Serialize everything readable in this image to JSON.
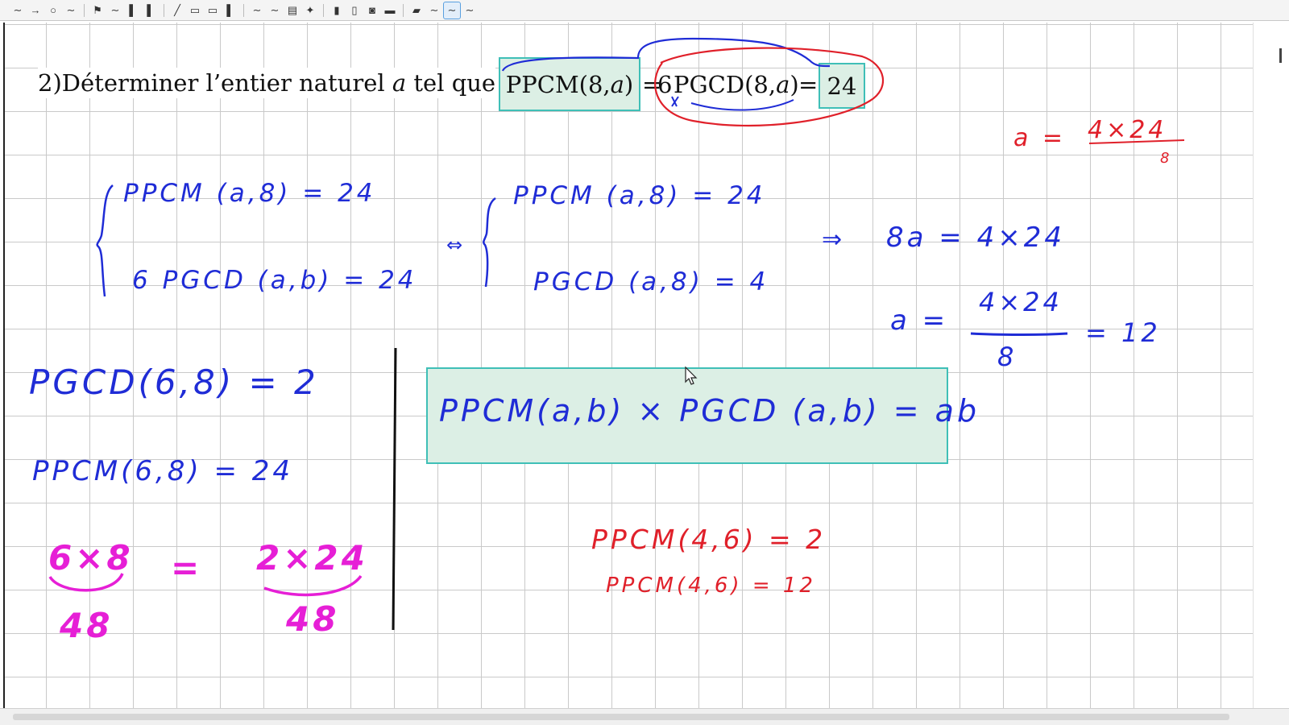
{
  "toolbar": {
    "tools": [
      {
        "icon": "pen-icon",
        "glyph": "∼"
      },
      {
        "icon": "arrow-icon",
        "glyph": "→"
      },
      {
        "icon": "circle-icon",
        "glyph": "○"
      },
      {
        "icon": "freehand-icon",
        "glyph": "∼"
      },
      {
        "icon": "sep"
      },
      {
        "icon": "flag-icon",
        "glyph": "⚑"
      },
      {
        "icon": "red-pen-icon",
        "glyph": "∼"
      },
      {
        "icon": "yellow-highlighter-icon",
        "glyph": "▌"
      },
      {
        "icon": "cyan-highlighter-icon",
        "glyph": "▌"
      },
      {
        "icon": "sep"
      },
      {
        "icon": "line-icon",
        "glyph": "╱"
      },
      {
        "icon": "text-icon",
        "glyph": "▭"
      },
      {
        "icon": "ruler-icon",
        "glyph": "▭"
      },
      {
        "icon": "green-marker-icon",
        "glyph": "▌"
      },
      {
        "icon": "sep"
      },
      {
        "icon": "wave-icon",
        "glyph": "∼"
      },
      {
        "icon": "wave2-icon",
        "glyph": "∼"
      },
      {
        "icon": "stamp-icon",
        "glyph": "▤"
      },
      {
        "icon": "figure-icon",
        "glyph": "✦"
      },
      {
        "icon": "sep"
      },
      {
        "icon": "book-icon",
        "glyph": "▮"
      },
      {
        "icon": "mobile-icon",
        "glyph": "▯"
      },
      {
        "icon": "camera-icon",
        "glyph": "◙"
      },
      {
        "icon": "screen-icon",
        "glyph": "▬"
      },
      {
        "icon": "sep"
      },
      {
        "icon": "record-icon",
        "glyph": "▰"
      },
      {
        "icon": "stroke-icon",
        "glyph": "∼"
      },
      {
        "icon": "active-pen-icon",
        "glyph": "∼",
        "active": true
      },
      {
        "icon": "stroke2-icon",
        "glyph": "∼"
      }
    ]
  },
  "title": {
    "prefix": "2)Déterminer l’entier naturel 𝑎 tel que",
    "box1": "PPCM(8,𝑎)",
    "eq1": "=",
    "six": "6",
    "pgcd": "PGCD(8,𝑎)",
    "eq2": "=",
    "box2": "24"
  },
  "notes": {
    "sys1_line1": "PPCM (a,8) = 24",
    "sys1_line2": "6 PGCD (a,b) = 24",
    "equiv": "⇔",
    "sys2_line1": "PPCM (a,8) = 24",
    "sys2_line2": "PGCD (a,8) = 4",
    "implies": "⇒",
    "eq_8a": "8a = 4×24",
    "a_lhs": "a =",
    "a_num": "4×24",
    "a_den": "8",
    "a_result": "= 12",
    "red_a_lhs": "a =",
    "red_a_num": "4×24",
    "red_a_den": "8",
    "pgcd_68": "PGCD(6,8) = 2",
    "ppcm_68": "PPCM(6,8) =  24",
    "mag_num_left": "6×8",
    "mag_eq": "=",
    "mag_num_right": "2×24",
    "mag_den_left": "48",
    "mag_den_right": "48",
    "formula": "PPCM(a,b) × PGCD (a,b) = ab",
    "red_ppcm1": "PPCM(4,6) = 2",
    "red_ppcm2": "PPCM(4,6) = 12"
  },
  "colors": {
    "blue_ink": "#1f2cd6",
    "red_ink": "#e0202a",
    "magenta_ink": "#e61fd6",
    "box_border": "#3fbfb7",
    "box_fill": "#dcefe5"
  }
}
